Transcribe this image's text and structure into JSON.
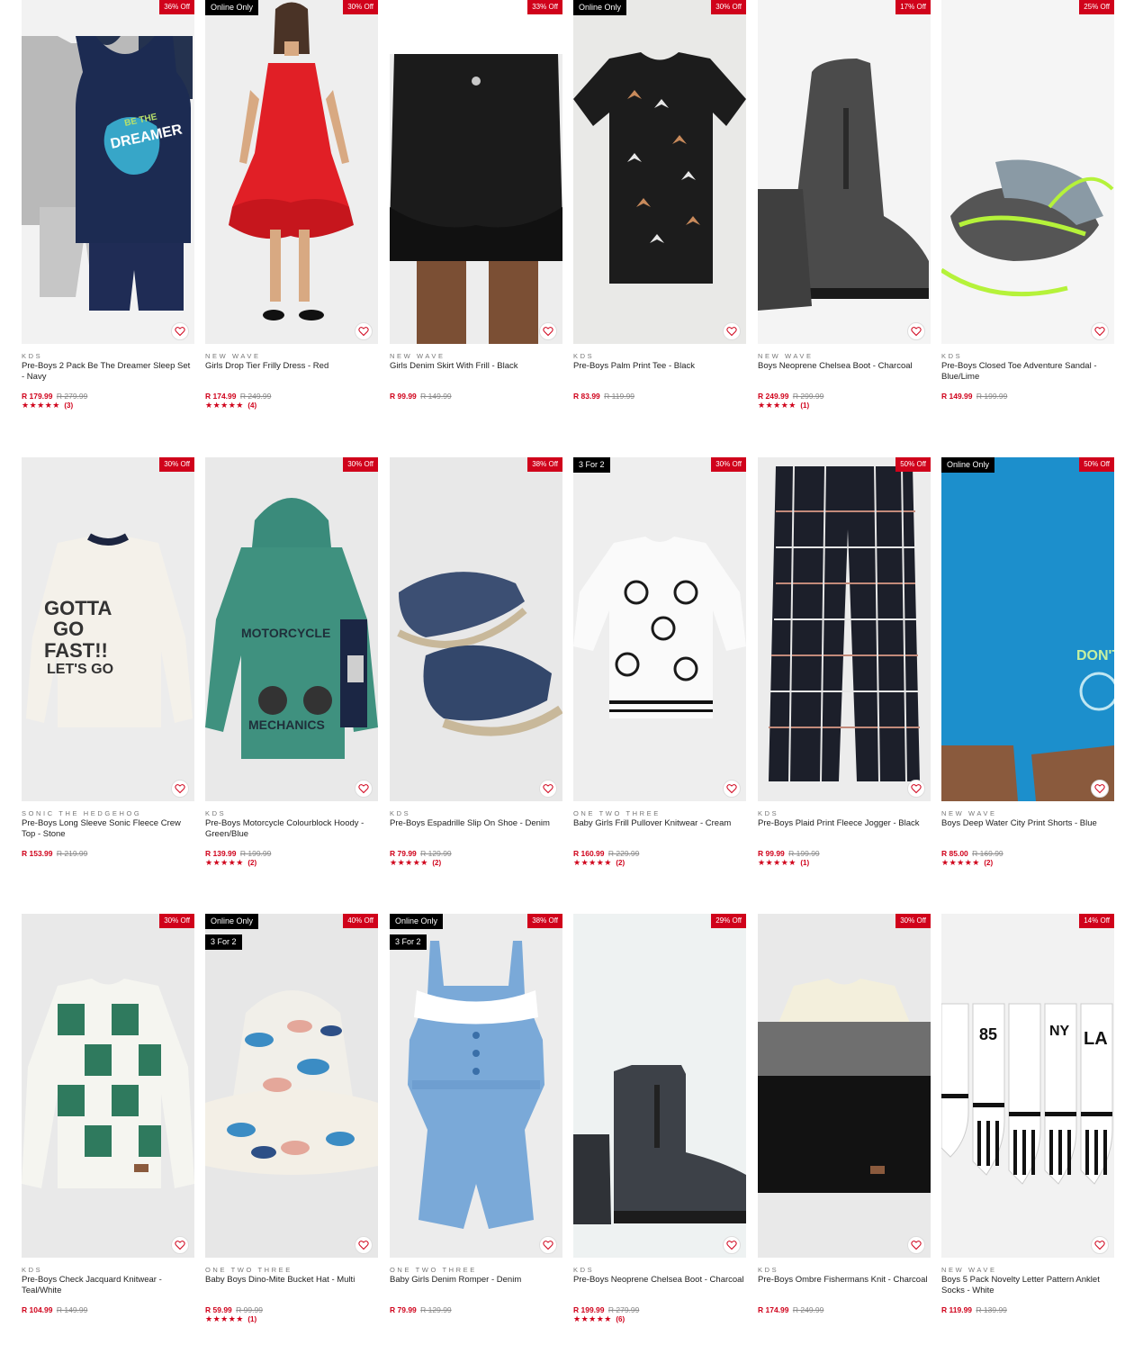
{
  "colors": {
    "sale": "#d0021b",
    "badge": "#000000"
  },
  "rows": [
    {
      "products": [
        {
          "brand": "KDS",
          "name": "Pre-Boys 2 Pack Be The Dreamer Sleep Set - Navy",
          "price": "R 179.99",
          "was": "R 279.99",
          "discount": "36% Off",
          "badges": [],
          "stars": "★★★★★",
          "count": "(3)",
          "image": "sleep-set",
          "bg": "#f2f2f2"
        },
        {
          "brand": "NEW WAVE",
          "name": "Girls Drop Tier Frilly Dress - Red",
          "price": "R 174.99",
          "was": "R 249.99",
          "discount": "30% Off",
          "badges": [
            "Online Only"
          ],
          "stars": "★★★★★",
          "count": "(4)",
          "image": "dress",
          "bg": "#eeeeee"
        },
        {
          "brand": "NEW WAVE",
          "name": "Girls Denim Skirt With Frill - Black",
          "price": "R 99.99",
          "was": "R 149.99",
          "discount": "33% Off",
          "badges": [],
          "stars": "",
          "count": "",
          "image": "skirt",
          "bg": "#ededed"
        },
        {
          "brand": "KDS",
          "name": "Pre-Boys Palm Print Tee - Black",
          "price": "R 83.99",
          "was": "R 119.99",
          "discount": "30% Off",
          "badges": [
            "Online Only"
          ],
          "stars": "",
          "count": "",
          "image": "tee",
          "bg": "#e9e9e7"
        },
        {
          "brand": "NEW WAVE",
          "name": "Boys Neoprene Chelsea Boot - Charcoal",
          "price": "R 249.99",
          "was": "R 299.99",
          "discount": "17% Off",
          "badges": [],
          "stars": "★★★★★",
          "count": "(1)",
          "image": "boot",
          "bg": "#f4f4f4"
        },
        {
          "brand": "KDS",
          "name": "Pre-Boys Closed Toe Adventure Sandal - Blue/Lime",
          "price": "R 149.99",
          "was": "R 199.99",
          "discount": "25% Off",
          "badges": [],
          "stars": "",
          "count": "",
          "image": "sandal",
          "bg": "#f5f5f5"
        }
      ]
    },
    {
      "products": [
        {
          "brand": "SONIC THE HEDGEHOG",
          "name": "Pre-Boys Long Sleeve Sonic Fleece Crew Top - Stone",
          "price": "R 153.99",
          "was": "R 219.99",
          "discount": "30% Off",
          "badges": [],
          "stars": "",
          "count": "",
          "image": "sonic",
          "bg": "#ececec"
        },
        {
          "brand": "KDS",
          "name": "Pre-Boys Motorcycle Colourblock Hoody - Green/Blue",
          "price": "R 139.99",
          "was": "R 199.99",
          "discount": "30% Off",
          "badges": [],
          "stars": "★★★★★",
          "count": "(2)",
          "image": "hoody",
          "bg": "#e9e9e9"
        },
        {
          "brand": "KDS",
          "name": "Pre-Boys Espadrille Slip On Shoe - Denim",
          "price": "R 79.99",
          "was": "R 129.99",
          "discount": "38% Off",
          "badges": [],
          "stars": "★★★★★",
          "count": "(2)",
          "image": "espadrille",
          "bg": "#e8e8e8"
        },
        {
          "brand": "ONE TWO THREE",
          "name": "Baby Girls Frill Pullover Knitwear - Cream",
          "price": "R 160.99",
          "was": "R 229.99",
          "discount": "30% Off",
          "badges": [
            "3 For 2"
          ],
          "stars": "★★★★★",
          "count": "(2)",
          "image": "knit-cream",
          "bg": "#eeeeee"
        },
        {
          "brand": "KDS",
          "name": "Pre-Boys Plaid Print Fleece Jogger - Black",
          "price": "R 99.99",
          "was": "R 199.99",
          "discount": "50% Off",
          "badges": [],
          "stars": "★★★★★",
          "count": "(1)",
          "image": "jogger",
          "bg": "#ececec"
        },
        {
          "brand": "NEW WAVE",
          "name": "Boys Deep Water City Print Shorts - Blue",
          "price": "R 85.00",
          "was": "R 169.99",
          "discount": "50% Off",
          "badges": [
            "Online Only"
          ],
          "stars": "★★★★★",
          "count": "(2)",
          "image": "shorts",
          "bg": "#e6e6e6"
        }
      ]
    },
    {
      "products": [
        {
          "brand": "KDS",
          "name": "Pre-Boys Check Jacquard Knitwear - Teal/White",
          "price": "R 104.99",
          "was": "R 149.99",
          "discount": "30% Off",
          "badges": [],
          "stars": "",
          "count": "",
          "image": "check-knit",
          "bg": "#e9e9e9"
        },
        {
          "brand": "ONE TWO THREE",
          "name": "Baby Boys Dino-Mite Bucket Hat - Multi",
          "price": "R 59.99",
          "was": "R 99.99",
          "discount": "40% Off",
          "badges": [
            "Online Only",
            "3 For 2"
          ],
          "stars": "★★★★★",
          "count": "(1)",
          "image": "hat",
          "bg": "#e7e7e7"
        },
        {
          "brand": "ONE TWO THREE",
          "name": "Baby Girls Denim Romper - Denim",
          "price": "R 79.99",
          "was": "R 129.99",
          "discount": "38% Off",
          "badges": [
            "Online Only",
            "3 For 2"
          ],
          "stars": "",
          "count": "",
          "image": "romper",
          "bg": "#ececec"
        },
        {
          "brand": "KDS",
          "name": "Pre-Boys Neoprene Chelsea Boot - Charcoal",
          "price": "R 199.99",
          "was": "R 279.99",
          "discount": "29% Off",
          "badges": [],
          "stars": "★★★★★",
          "count": "(6)",
          "image": "boot2",
          "bg": "#eef2f2"
        },
        {
          "brand": "KDS",
          "name": "Pre-Boys Ombre Fishermans Knit - Charcoal",
          "price": "R 174.99",
          "was": "R 249.99",
          "discount": "30% Off",
          "badges": [],
          "stars": "",
          "count": "",
          "image": "ombre",
          "bg": "#e9e9e9"
        },
        {
          "brand": "NEW WAVE",
          "name": "Boys 5 Pack Novelty Letter Pattern Anklet Socks - White",
          "price": "R 119.99",
          "was": "R 139.99",
          "discount": "14% Off",
          "badges": [],
          "stars": "",
          "count": "",
          "image": "socks",
          "bg": "#f2f2f2"
        }
      ]
    }
  ]
}
